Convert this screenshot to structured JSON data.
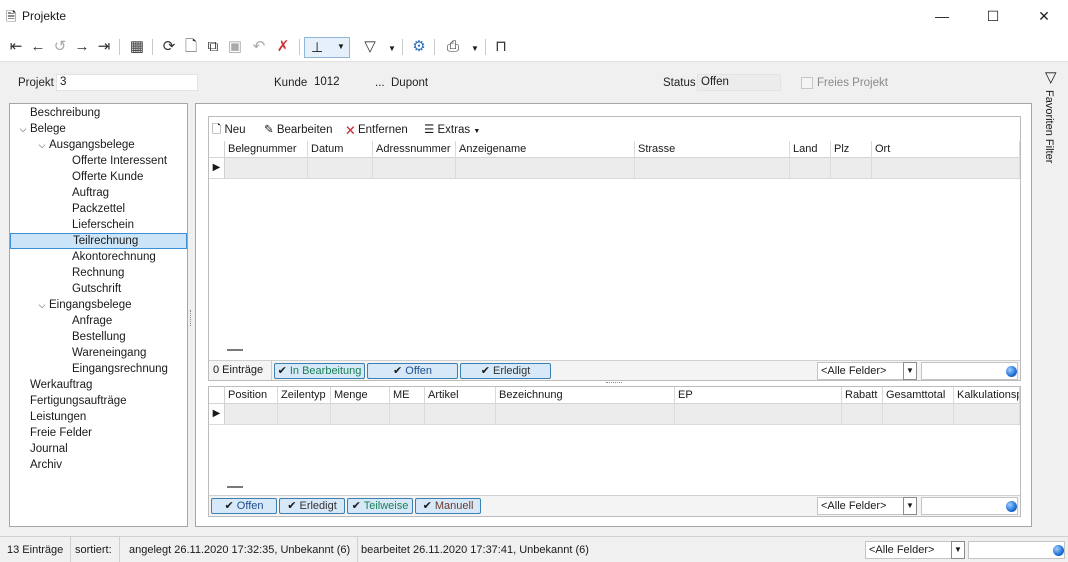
{
  "window": {
    "title": "Projekte"
  },
  "header": {
    "projekt_label": "Projekt",
    "projekt_value": "3",
    "kunde_label": "Kunde",
    "kunde_value": "1012",
    "kunde_lookup": "...",
    "kunde_name": "Dupont",
    "status_label": "Status",
    "status_value": "Offen",
    "freies_projekt_label": "Freies Projekt"
  },
  "tree": {
    "items": [
      {
        "label": "Beschreibung",
        "level": 0
      },
      {
        "label": "Belege",
        "level": 0,
        "expanded": true
      },
      {
        "label": "Ausgangsbelege",
        "level": 1,
        "expanded": true
      },
      {
        "label": "Offerte Interessent",
        "level": 2
      },
      {
        "label": "Offerte Kunde",
        "level": 2
      },
      {
        "label": "Auftrag",
        "level": 2
      },
      {
        "label": "Packzettel",
        "level": 2
      },
      {
        "label": "Lieferschein",
        "level": 2
      },
      {
        "label": "Teilrechnung",
        "level": 2,
        "selected": true
      },
      {
        "label": "Akontorechnung",
        "level": 2
      },
      {
        "label": "Rechnung",
        "level": 2
      },
      {
        "label": "Gutschrift",
        "level": 2
      },
      {
        "label": "Eingangsbelege",
        "level": 1,
        "expanded": true
      },
      {
        "label": "Anfrage",
        "level": 2
      },
      {
        "label": "Bestellung",
        "level": 2
      },
      {
        "label": "Wareneingang",
        "level": 2
      },
      {
        "label": "Eingangsrechnung",
        "level": 2
      },
      {
        "label": "Werkauftrag",
        "level": 0
      },
      {
        "label": "Fertigungsaufträge",
        "level": 0
      },
      {
        "label": "Leistungen",
        "level": 0
      },
      {
        "label": "Freie Felder",
        "level": 0
      },
      {
        "label": "Journal",
        "level": 0
      },
      {
        "label": "Archiv",
        "level": 0
      }
    ]
  },
  "actions": {
    "neu": "Neu",
    "bearbeiten": "Bearbeiten",
    "entfernen": "Entfernen",
    "extras": "Extras"
  },
  "grid1": {
    "columns": [
      {
        "label": "Belegnummer",
        "w": 83
      },
      {
        "label": "Datum",
        "w": 65
      },
      {
        "label": "Adressnummer",
        "w": 83
      },
      {
        "label": "Anzeigename",
        "w": 179
      },
      {
        "label": "Strasse",
        "w": 155
      },
      {
        "label": "Land",
        "w": 41
      },
      {
        "label": "Plz",
        "w": 41
      },
      {
        "label": "Ort",
        "w": 148
      }
    ],
    "count": "0 Einträge",
    "chips": [
      {
        "label": "In Bearbeitung",
        "color": "#1a7f55"
      },
      {
        "label": "Offen",
        "color": "#1f4f8c"
      },
      {
        "label": "Erledigt",
        "color": "#333333"
      }
    ],
    "filter": "<Alle Felder>"
  },
  "grid2": {
    "columns": [
      {
        "label": "Position",
        "w": 53
      },
      {
        "label": "Zeilentyp",
        "w": 53
      },
      {
        "label": "Menge",
        "w": 59
      },
      {
        "label": "ME",
        "w": 35
      },
      {
        "label": "Artikel",
        "w": 71
      },
      {
        "label": "Bezeichnung",
        "w": 179
      },
      {
        "label": "EP",
        "w": 167
      },
      {
        "label": "Rabatt",
        "w": 41
      },
      {
        "label": "Gesamttotal",
        "w": 71
      },
      {
        "label": "Kalkulationsp",
        "w": 66
      }
    ],
    "chips": [
      {
        "label": "Offen",
        "color": "#1f4f8c"
      },
      {
        "label": "Erledigt",
        "color": "#333333"
      },
      {
        "label": "Teilweise",
        "color": "#1a7f55"
      },
      {
        "label": "Manuell",
        "color": "#6b3a2a"
      }
    ],
    "filter": "<Alle Felder>"
  },
  "sidebar_right": {
    "favoriten_filter": "Favoriten Filter"
  },
  "bottom": {
    "count": "13 Einträge",
    "sortiert": "sortiert:",
    "angelegt": "angelegt 26.11.2020 17:32:35, Unbekannt (6)",
    "bearbeitet": "bearbeitet 26.11.2020 17:37:41, Unbekannt (6)",
    "filter": "<Alle Felder>"
  }
}
